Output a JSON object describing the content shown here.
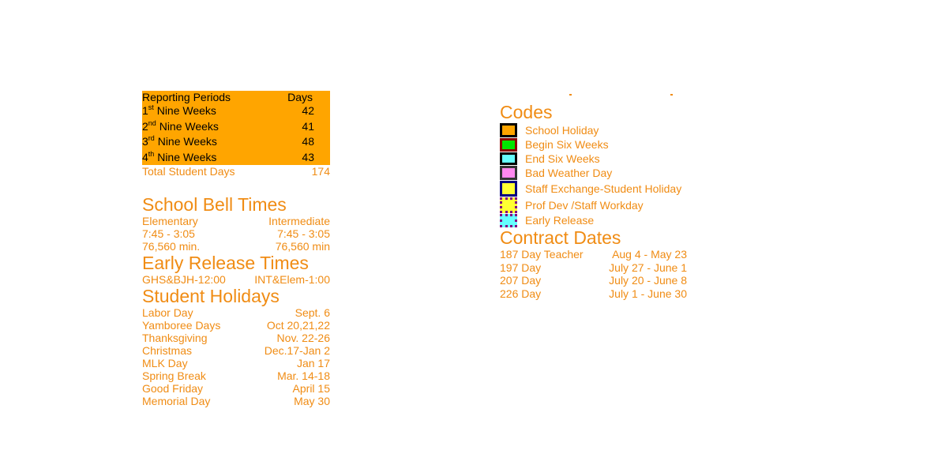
{
  "reporting_periods": {
    "header": {
      "label": "Reporting Periods",
      "days": "Days"
    },
    "rows": [
      {
        "num": "1",
        "sup": "st",
        "label": "Nine Weeks",
        "days": "42"
      },
      {
        "num": "2",
        "sup": "nd",
        "label": "Nine Weeks",
        "days": "41"
      },
      {
        "num": "3",
        "sup": "rd",
        "label": "Nine Weeks",
        "days": "48"
      },
      {
        "num": "4",
        "sup": "th",
        "label": "Nine Weeks",
        "days": "43"
      }
    ],
    "total": {
      "label": "Total Student Days",
      "days": "174"
    },
    "bg_color": "#ffa500"
  },
  "bell_times": {
    "title": "School Bell Times",
    "rows": [
      {
        "left": "Elementary",
        "right": "Intermediate"
      },
      {
        "left": "7:45 - 3:05",
        "right": "7:45 - 3:05"
      },
      {
        "left": "76,560 min.",
        "right": "76,560 min"
      }
    ]
  },
  "early_release": {
    "title": "Early Release Times",
    "rows": [
      {
        "left": "GHS&BJH-12:00",
        "right": "INT&Elem-1:00"
      }
    ]
  },
  "student_holidays": {
    "title": "Student Holidays",
    "rows": [
      {
        "name": "Labor Day",
        "date": "Sept. 6"
      },
      {
        "name": "Yamboree Days",
        "date": "Oct 20,21,22"
      },
      {
        "name": "Thanksgiving",
        "date": "Nov. 22-26"
      },
      {
        "name": "Christmas",
        "date": "Dec.17-Jan 2"
      },
      {
        "name": "MLK Day",
        "date": "Jan 17"
      },
      {
        "name": "Spring Break",
        "date": "Mar. 14-18"
      },
      {
        "name": "Good Friday",
        "date": "April 15"
      },
      {
        "name": "Memorial Day",
        "date": "May 30"
      }
    ],
    "clipped_next_heading": "Codes"
  },
  "codes": {
    "title": "Codes",
    "items": [
      {
        "label": "School Holiday",
        "fill": "#ffa500",
        "border": "#000000",
        "style": "solid"
      },
      {
        "label": "Begin Six Weeks",
        "fill": "#00e600",
        "border": "#8b0000",
        "style": "solid"
      },
      {
        "label": "End Six Weeks",
        "fill": "#66ffff",
        "border": "#000000",
        "style": "solid"
      },
      {
        "label": "Bad Weather Day",
        "fill": "#ff88ee",
        "border": "#333333",
        "style": "solid"
      },
      {
        "label": "Staff Exchange-Student Holiday",
        "fill": "#ffff33",
        "border": "#000080",
        "style": "solid"
      },
      {
        "label": "Prof Dev /Staff Workday",
        "fill": "#ffff33",
        "border": "#800080",
        "style": "dotted"
      },
      {
        "label": "Early Release",
        "fill": "#66ffff",
        "border": "#800080",
        "style": "dotted"
      }
    ]
  },
  "contract_dates": {
    "title": "Contract Dates",
    "rows": [
      {
        "label": "187 Day Teacher",
        "dates": "Aug 4 - May 23"
      },
      {
        "label": "197 Day",
        "dates": "July 27 - June 1"
      },
      {
        "label": "207 Day",
        "dates": "July 20 - June 8"
      },
      {
        "label": "226 Day",
        "dates": "July 1 - June 30"
      }
    ]
  },
  "text_color": "#f08c14"
}
